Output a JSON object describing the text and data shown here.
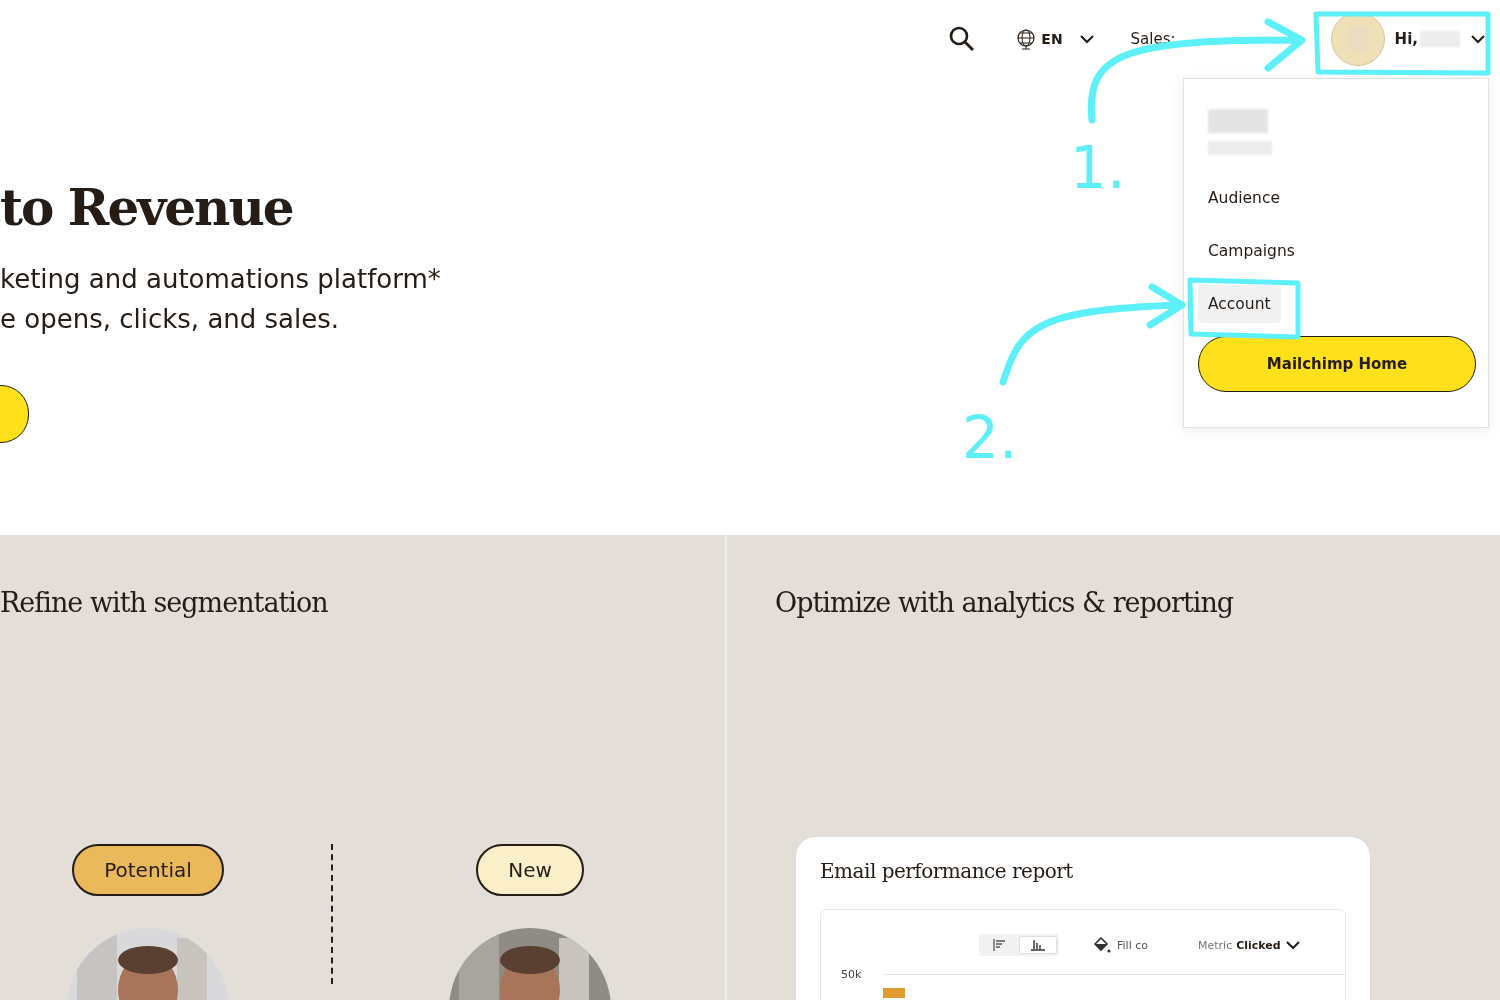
{
  "header": {
    "language": "EN",
    "sales": "Sales:",
    "greeting": "Hi,"
  },
  "account_menu": {
    "items": [
      {
        "label": "Audience",
        "selected": false
      },
      {
        "label": "Campaigns",
        "selected": false
      },
      {
        "label": "Account",
        "selected": true
      }
    ],
    "button": "Mailchimp Home"
  },
  "hero": {
    "title": "to Revenue",
    "subtitle_lines": [
      "keting and automations platform*",
      "e opens, clicks, and sales."
    ]
  },
  "features": [
    {
      "title": "Refine with segmentation"
    },
    {
      "title": "Optimize with analytics & reporting"
    }
  ],
  "segments": [
    {
      "label": "Potential",
      "color": "#e9b95c"
    },
    {
      "label": "New",
      "color": "#fbefc9"
    }
  ],
  "report": {
    "title": "Email performance report",
    "view_toggle": [
      {
        "kind": "horizontal",
        "selected": false
      },
      {
        "kind": "vertical",
        "selected": true
      }
    ],
    "fill_label": "Fill co",
    "metric_label": "Metric",
    "metric_value": "Clicked",
    "y_tick": "50k"
  },
  "annotations": [
    {
      "label": "1."
    },
    {
      "label": "2."
    }
  ]
}
